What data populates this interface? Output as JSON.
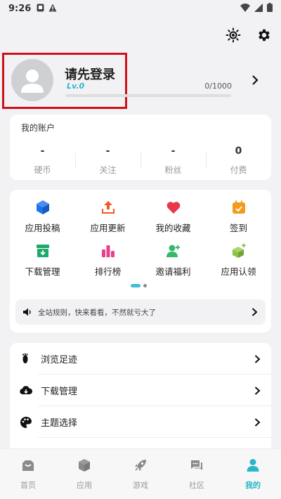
{
  "status_bar": {
    "time": "9:26"
  },
  "profile": {
    "name": "请先登录",
    "level": "Lv.0",
    "progress_text": "0/1000",
    "progress_fraction": 0
  },
  "account": {
    "title": "我的账户",
    "stats": [
      {
        "value": "-",
        "label": "硬币"
      },
      {
        "value": "-",
        "label": "关注"
      },
      {
        "value": "-",
        "label": "粉丝"
      },
      {
        "value": "0",
        "label": "付费"
      }
    ]
  },
  "grid": {
    "items": [
      {
        "label": "应用投稿",
        "icon": "cube-icon",
        "color": "#1e73e8"
      },
      {
        "label": "应用更新",
        "icon": "upload-icon",
        "color": "#f05a28"
      },
      {
        "label": "我的收藏",
        "icon": "heart-icon",
        "color": "#e8374a"
      },
      {
        "label": "签到",
        "icon": "calendar-check-icon",
        "color": "#f59a1b"
      },
      {
        "label": "下载管理",
        "icon": "download-box-icon",
        "color": "#1faa6b"
      },
      {
        "label": "排行榜",
        "icon": "bar-chart-icon",
        "color": "#e8408c"
      },
      {
        "label": "邀请福利",
        "icon": "add-person-icon",
        "color": "#35b86a"
      },
      {
        "label": "应用认领",
        "icon": "cube-plus-icon",
        "color": "#8bc34a"
      }
    ]
  },
  "notice": {
    "text": "全站规则，快来看看，不然就亏大了"
  },
  "menu": {
    "items": [
      {
        "label": "浏览足迹",
        "icon": "footprint-icon"
      },
      {
        "label": "下载管理",
        "icon": "cloud-download-icon"
      },
      {
        "label": "主题选择",
        "icon": "palette-icon"
      }
    ]
  },
  "bottom_nav": {
    "items": [
      {
        "label": "首页",
        "icon": "home-bag-icon",
        "active": false
      },
      {
        "label": "应用",
        "icon": "box-icon",
        "active": false
      },
      {
        "label": "游戏",
        "icon": "rocket-icon",
        "active": false
      },
      {
        "label": "社区",
        "icon": "chat-icon",
        "active": false
      },
      {
        "label": "我的",
        "icon": "person-icon",
        "active": true
      }
    ],
    "accent_color": "#2bb5c8"
  }
}
